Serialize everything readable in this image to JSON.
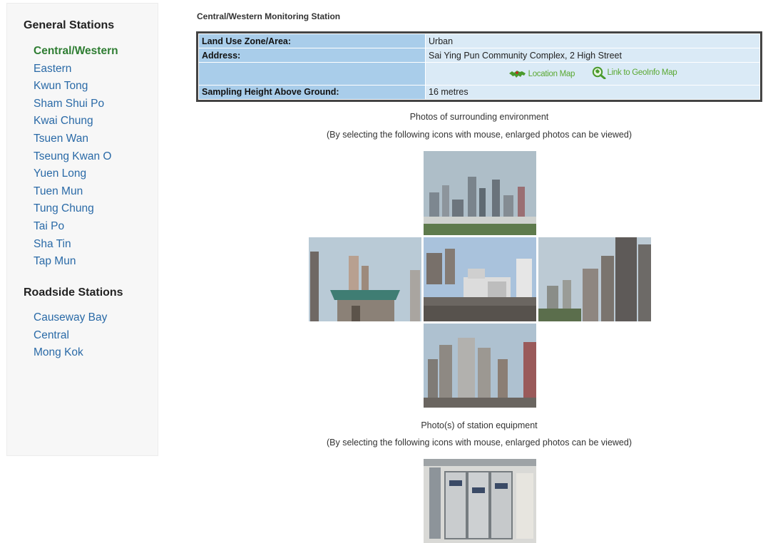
{
  "sidebar": {
    "general_heading": "General Stations",
    "general_items": [
      "Central/Western",
      "Eastern",
      "Kwun Tong",
      "Sham Shui Po",
      "Kwai Chung",
      "Tsuen Wan",
      "Tseung Kwan O",
      "Yuen Long",
      "Tuen Mun",
      "Tung Chung",
      "Tai Po",
      "Sha Tin",
      "Tap Mun"
    ],
    "active_item": "Central/Western",
    "roadside_heading": "Roadside Stations",
    "roadside_items": [
      "Causeway Bay",
      "Central",
      "Mong Kok"
    ]
  },
  "main": {
    "title": "Central/Western Monitoring Station",
    "info": {
      "land_use_label": "Land Use Zone/Area:",
      "land_use_value": "Urban",
      "address_label": "Address:",
      "address_value": "Sai Ying Pun Community Complex, 2 High Street",
      "location_map_label": "Location Map",
      "geoinfo_label": "Link to GeoInfo Map",
      "height_label": "Sampling Height Above Ground:",
      "height_value": "16 metres"
    },
    "surroundings_caption": "Photos of surrounding environment",
    "surroundings_hint": "(By selecting the following icons with mouse, enlarged photos can be viewed)",
    "equipment_caption": "Photo(s) of station equipment",
    "equipment_hint": "(By selecting the following icons with mouse, enlarged photos can be viewed)"
  },
  "colors": {
    "label_bg": "#a9cdea",
    "value_bg": "#daeaf6",
    "link_green": "#5aa832",
    "active_green": "#2e7d32",
    "nav_blue": "#2a6aa7"
  }
}
